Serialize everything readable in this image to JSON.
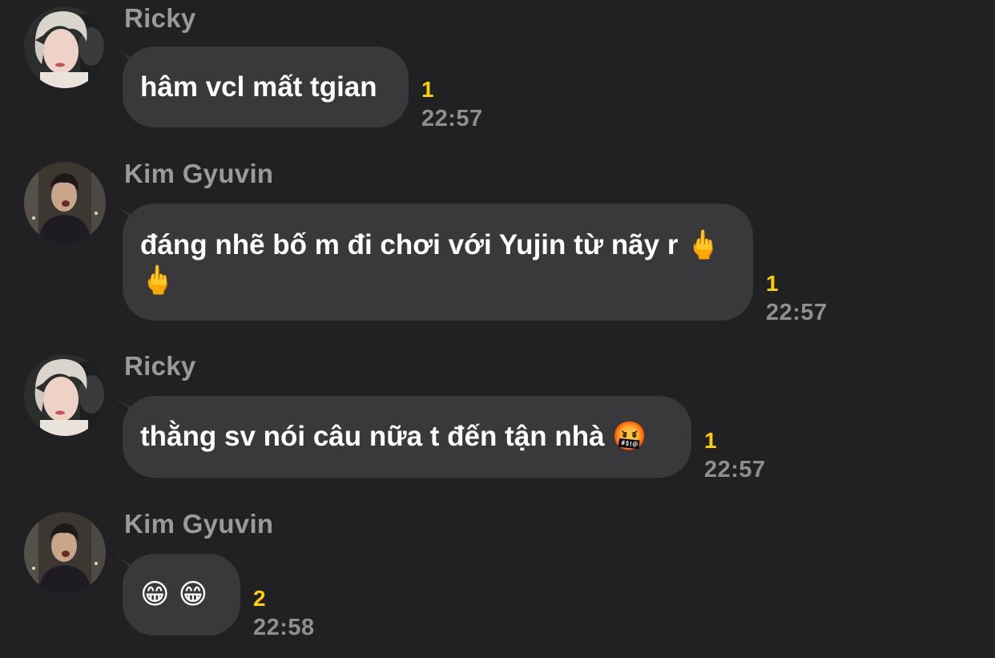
{
  "messages": [
    {
      "sender": "Ricky",
      "avatar": "ricky-avatar",
      "lines": [
        "hâm vcl mất tgian"
      ],
      "unread": "1",
      "time": "22:57"
    },
    {
      "sender": "Kim Gyuvin",
      "avatar": "kim-gyuvin-avatar",
      "lines": [
        "đáng nhẽ bố m đi chơi với Yujin từ nãy r 🖕",
        "🖕"
      ],
      "unread": "1",
      "time": "22:57"
    },
    {
      "sender": "Ricky",
      "avatar": "ricky-avatar",
      "lines": [
        "thằng sv nói câu nữa t đến tận nhà 🤬"
      ],
      "unread": "1",
      "time": "22:57"
    },
    {
      "sender": "Kim Gyuvin",
      "avatar": "kim-gyuvin-avatar",
      "lines": [
        "😁 😁"
      ],
      "unread": "2",
      "time": "22:58"
    }
  ],
  "colors": {
    "background": "#212123",
    "bubble": "#39393b",
    "sender": "#9a9a9d",
    "unread": "#ffd000",
    "time": "#8f8f92"
  }
}
